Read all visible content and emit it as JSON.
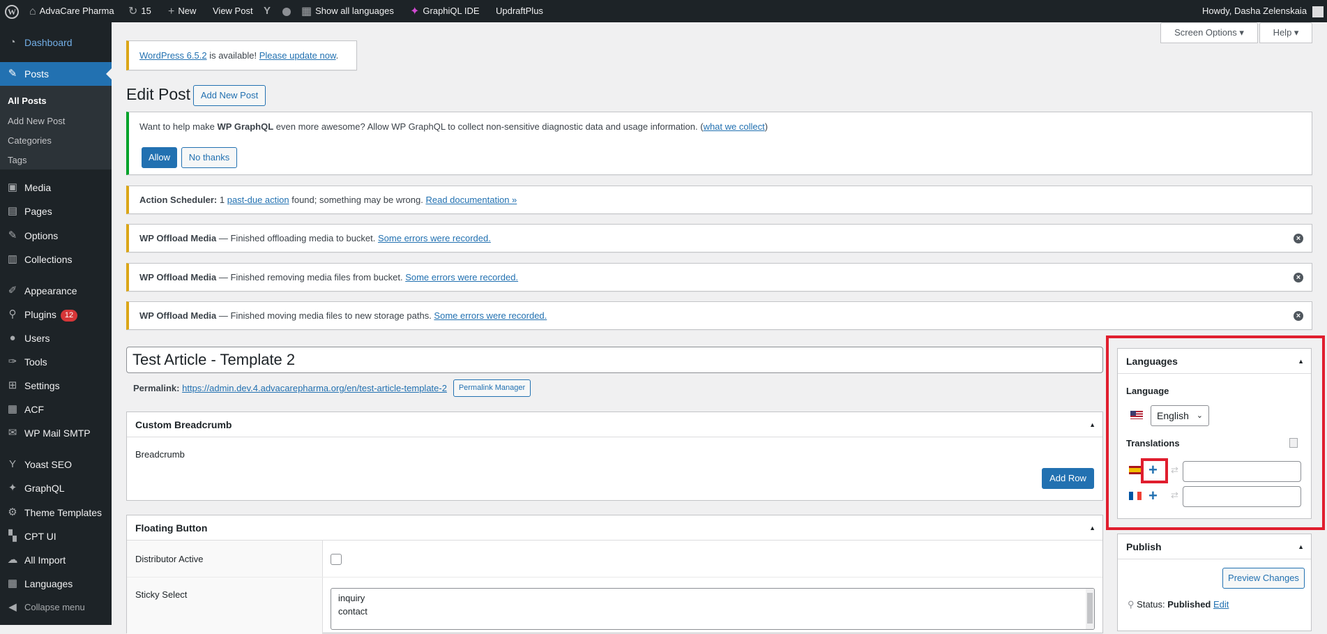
{
  "adminbar": {
    "site_name": "AdvaCare Pharma",
    "updates_count": "15",
    "new_label": "New",
    "view_post": "View Post",
    "show_languages": "Show all languages",
    "graphiql": "GraphiQL IDE",
    "updraft": "UpdraftPlus",
    "howdy": "Howdy, Dasha Zelenskaia"
  },
  "sidebar": {
    "dashboard": "Dashboard",
    "posts": "Posts",
    "sub_all_posts": "All Posts",
    "sub_add_new": "Add New Post",
    "sub_categories": "Categories",
    "sub_tags": "Tags",
    "media": "Media",
    "pages": "Pages",
    "options": "Options",
    "collections": "Collections",
    "appearance": "Appearance",
    "plugins": "Plugins",
    "plugins_badge": "12",
    "users": "Users",
    "tools": "Tools",
    "settings": "Settings",
    "acf": "ACF",
    "wp_mail_smtp": "WP Mail SMTP",
    "yoast": "Yoast SEO",
    "graphql": "GraphQL",
    "theme_templates": "Theme Templates",
    "cpt_ui": "CPT UI",
    "all_import": "All Import",
    "languages": "Languages",
    "collapse": "Collapse menu"
  },
  "screen_options": "Screen Options ▾",
  "help": "Help ▾",
  "update_notice": {
    "link1": "WordPress 6.5.2",
    "mid": " is available! ",
    "link2": "Please update now",
    "end": "."
  },
  "page_title": "Edit Post",
  "add_new_post_button": "Add New Post",
  "graphql_notice": {
    "pre": "Want to help make ",
    "bold": "WP GraphQL",
    "mid": " even more awesome? Allow WP GraphQL to collect non-sensitive diagnostic data and usage information. (",
    "link": "what we collect",
    "end": ")",
    "allow": "Allow",
    "no_thanks": "No thanks"
  },
  "action_scheduler": {
    "bold": "Action Scheduler:",
    "pre": " 1 ",
    "link1": "past-due action",
    "mid": " found; something may be wrong. ",
    "link2": "Read documentation »"
  },
  "offload_notices": [
    {
      "bold": "WP Offload Media",
      "text": " — Finished offloading media to bucket. ",
      "link": "Some errors were recorded."
    },
    {
      "bold": "WP Offload Media",
      "text": " — Finished removing media files from bucket. ",
      "link": "Some errors were recorded."
    },
    {
      "bold": "WP Offload Media",
      "text": " — Finished moving media files to new storage paths. ",
      "link": "Some errors were recorded."
    }
  ],
  "post_title": "Test Article - Template 2",
  "permalink": {
    "label": "Permalink:",
    "url": "https://admin.dev.4.advacarepharma.org/en/test-article-template-2",
    "manager_button": "Permalink Manager"
  },
  "custom_breadcrumb": {
    "title": "Custom Breadcrumb",
    "field_label": "Breadcrumb",
    "add_row": "Add Row"
  },
  "floating_button": {
    "title": "Floating Button",
    "distributor_label": "Distributor Active",
    "sticky_label": "Sticky Select",
    "sticky_options": [
      "inquiry",
      "contact"
    ]
  },
  "languages_box": {
    "title": "Languages",
    "language_label": "Language",
    "language_value": "English",
    "translations_label": "Translations"
  },
  "publish_box": {
    "title": "Publish",
    "preview": "Preview Changes",
    "status_label": "Status:",
    "status_value": "Published",
    "edit": "Edit"
  },
  "colors": {
    "adminbar_bg": "#1d2327",
    "accent": "#2271b1",
    "warning": "#dba617",
    "success": "#00a32a",
    "highlight": "#e01e2e"
  }
}
